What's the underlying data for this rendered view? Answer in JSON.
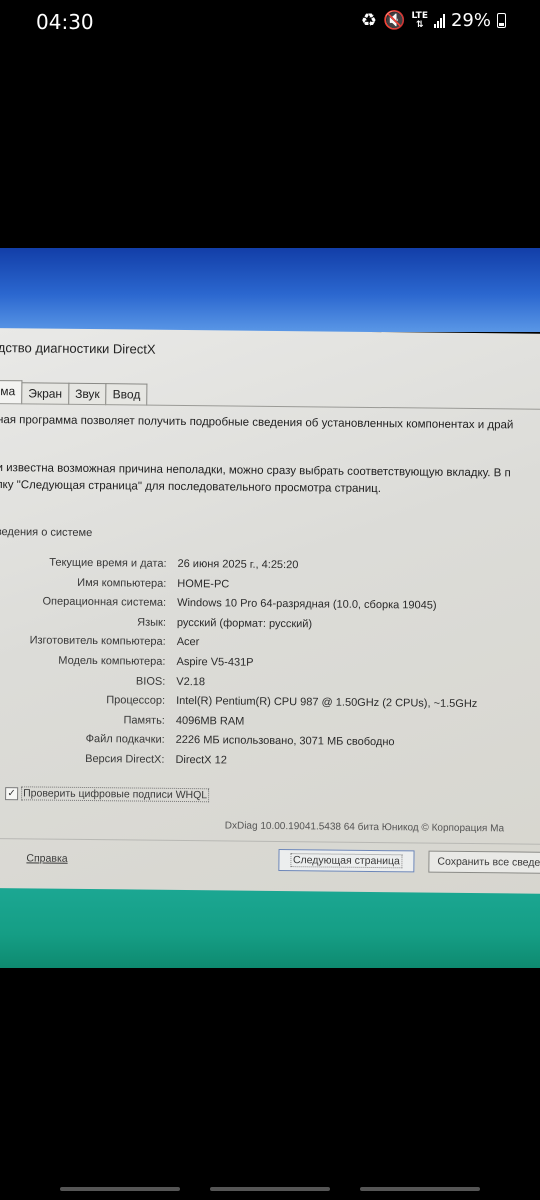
{
  "status_bar": {
    "time": "04:30",
    "network": "LTE",
    "battery": "29%"
  },
  "window": {
    "title": "дство диагностики DirectX",
    "tabs": [
      "ма",
      "Экран",
      "Звук",
      "Ввод"
    ],
    "intro_line": "ная программа позволяет получить подробные сведения об установленных компонентах и драй",
    "hint_line1": "и известна возможная причина неполадки, можно сразу выбрать соответствующую вкладку. В п",
    "hint_line2": "пку \"Следующая страница\" для последовательного просмотра страниц.",
    "section_title": "ведения о системе",
    "system_info": [
      {
        "label": "Текущие время и дата:",
        "value": "26 июня 2025 г., 4:25:20"
      },
      {
        "label": "Имя компьютера:",
        "value": "HOME-PC"
      },
      {
        "label": "Операционная система:",
        "value": "Windows 10 Pro 64-разрядная (10.0, сборка 19045)"
      },
      {
        "label": "Язык:",
        "value": "русский (формат: русский)"
      },
      {
        "label": "Изготовитель компьютера:",
        "value": "Acer"
      },
      {
        "label": "Модель компьютера:",
        "value": "Aspire V5-431P"
      },
      {
        "label": "BIOS:",
        "value": "V2.18"
      },
      {
        "label": "Процессор:",
        "value": "Intel(R) Pentium(R) CPU 987 @ 1.50GHz (2 CPUs), ~1.5GHz"
      },
      {
        "label": "Память:",
        "value": "4096MB RAM"
      },
      {
        "label": "Файл подкачки:",
        "value": "2226 МБ использовано, 3071 МБ свободно"
      },
      {
        "label": "Версия DirectX:",
        "value": "DirectX 12"
      }
    ],
    "whql_checkbox": {
      "label": "Проверить цифровые подписи WHQL",
      "checked": true
    },
    "version_text": "DxDiag 10.00.19041.5438 64 бита Юникод © Корпорация Ма",
    "buttons": {
      "help": "Справка",
      "next": "Следующая страница",
      "save": "Сохранить все сведения"
    }
  }
}
